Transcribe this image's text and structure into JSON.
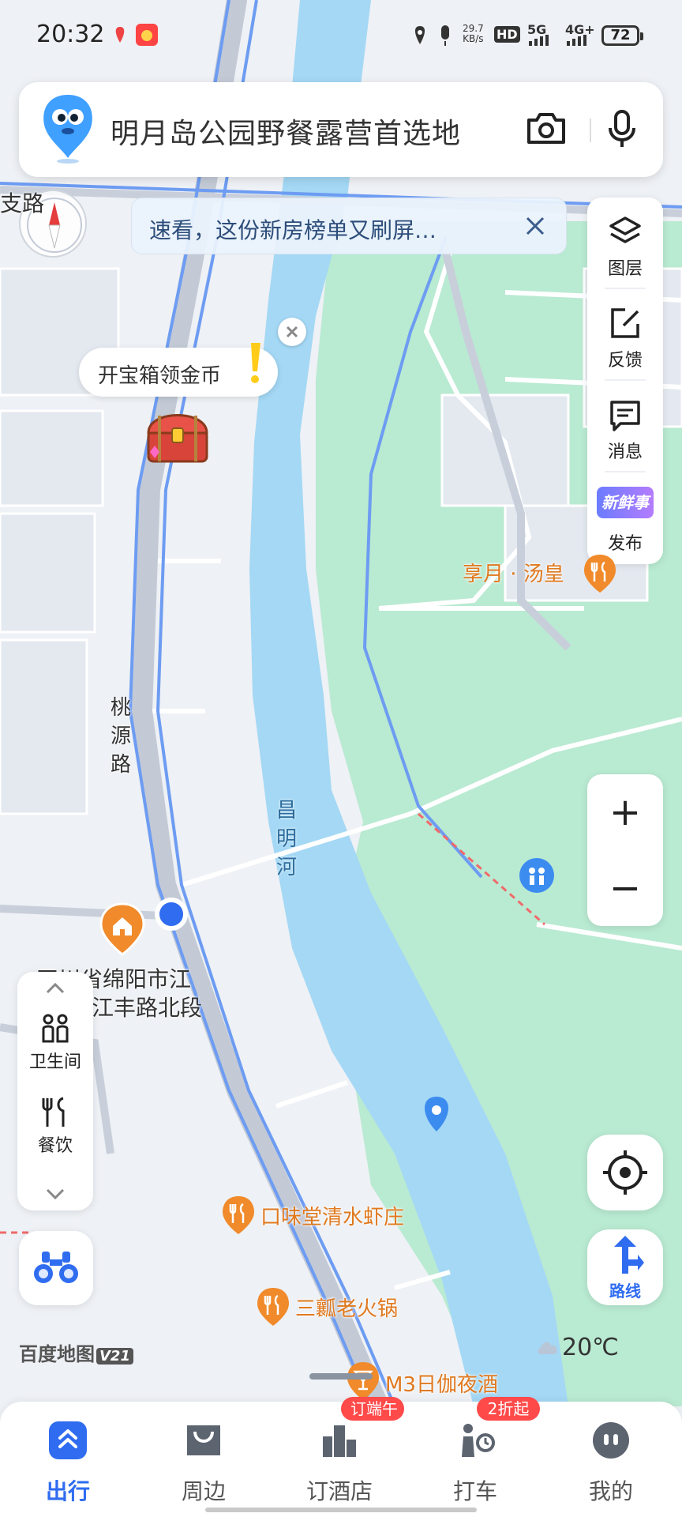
{
  "status_bar": {
    "time": "20:32",
    "net_speed": "29.7",
    "net_unit": "KB/s",
    "hd": "HD",
    "sig1": "5G",
    "sig2": "4G+",
    "battery": "72"
  },
  "search": {
    "query": "明月岛公园野餐露营首选地",
    "camera_icon": "camera-icon",
    "mic_icon": "mic-icon"
  },
  "notice": {
    "text": "速看，这份新房榜单又刷屏…"
  },
  "tools": [
    {
      "label": "图层",
      "icon": "layers-icon"
    },
    {
      "label": "反馈",
      "icon": "feedback-icon"
    },
    {
      "label": "消息",
      "icon": "message-icon"
    },
    {
      "label": "发布",
      "icon": "fresh-news-icon",
      "badge_text": "新鲜事"
    }
  ],
  "treasure": {
    "text": "开宝箱领金币"
  },
  "map_labels": {
    "road_fragment": "支路",
    "taoyuan_road": [
      "桃",
      "源",
      "路"
    ],
    "river": [
      "昌",
      "明",
      "河"
    ],
    "address_line1": "四川省绵阳市江",
    "address_line2": "江丰路北段",
    "xiangyue": "享月 · 汤皇",
    "kouweitang": "口味堂清水虾庄",
    "sanrang": "三瓤老火锅",
    "m3": "M3日伽夜酒"
  },
  "poi_panel": {
    "toilet": "卫生间",
    "food": "餐饮"
  },
  "route": {
    "label": "路线"
  },
  "zoom": {
    "plus": "+",
    "minus": "−"
  },
  "brand": {
    "name": "百度地图",
    "version": "V21"
  },
  "weather": {
    "temp": "20℃"
  },
  "nav": {
    "tabs": [
      {
        "label": "出行",
        "icon": "travel-icon",
        "active": true
      },
      {
        "label": "周边",
        "icon": "nearby-icon",
        "active": false
      },
      {
        "label": "订酒店",
        "icon": "hotel-icon",
        "active": false,
        "badge": "订端午"
      },
      {
        "label": "打车",
        "icon": "taxi-icon",
        "active": false,
        "badge": "2折起"
      },
      {
        "label": "我的",
        "icon": "profile-icon",
        "active": false
      }
    ]
  },
  "colors": {
    "accent": "#2f6cf0",
    "river": "#a4d8f5",
    "park": "#b9ead2",
    "road": "#c6cedc",
    "road_line": "#6d9cf2",
    "poi_orange": "#f08a2a"
  }
}
